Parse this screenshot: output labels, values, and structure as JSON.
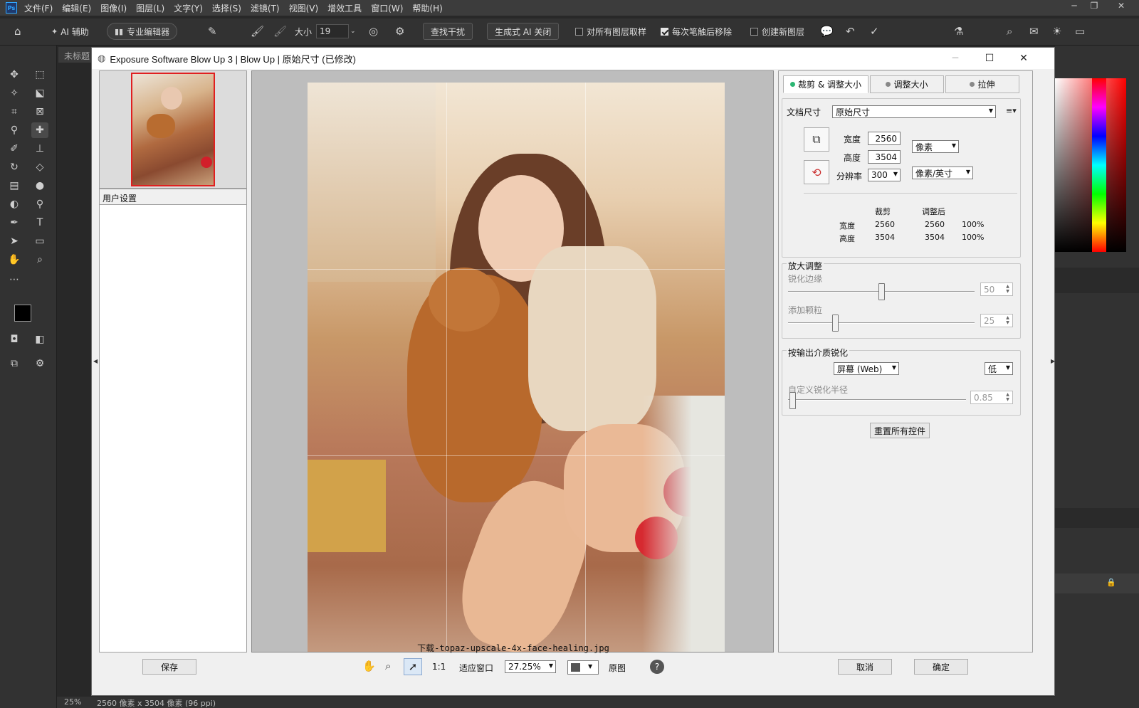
{
  "app": {
    "logo": "Ps",
    "menu": [
      "文件(F)",
      "编辑(E)",
      "图像(I)",
      "图层(L)",
      "文字(Y)",
      "选择(S)",
      "滤镜(T)",
      "视图(V)",
      "增效工具",
      "窗口(W)",
      "帮助(H)"
    ]
  },
  "options": {
    "ai_assist": "AI 辅助",
    "pro_editor": "专业编辑器",
    "size_label": "大小",
    "size_value": "19",
    "find_distractions": "查找干扰",
    "gen_ai_off": "生成式 AI 关闭",
    "sample_all_layers": "对所有图层取样",
    "sample_all_checked": false,
    "remove_after_stroke": "每次笔触后移除",
    "remove_after_checked": true,
    "create_new_layer": "创建新图层",
    "create_new_checked": false
  },
  "doc_tab": "未标题",
  "status": {
    "zoom": "25%",
    "info": "2560 像素 x 3504 像素 (96 ppi)"
  },
  "dialog": {
    "title": "Exposure Software Blow Up 3 | Blow Up | 原始尺寸 (已修改)",
    "user_settings": "用户设置",
    "save": "保存",
    "filename": "下载-topaz-upscale-4x-face-healing.jpg",
    "tabs": [
      "裁剪 & 调整大小",
      "调整大小",
      "拉伸"
    ],
    "doc_size_label": "文档尺寸",
    "doc_size_value": "原始尺寸",
    "width_label": "宽度",
    "width_value": "2560",
    "height_label": "高度",
    "height_value": "3504",
    "unit": "像素",
    "resolution_label": "分辨率",
    "resolution_value": "300",
    "res_unit": "像素/英寸",
    "table": {
      "col_crop": "裁剪",
      "col_after": "调整后",
      "rows": [
        {
          "label": "宽度",
          "crop": "2560",
          "after": "2560",
          "pct": "100%"
        },
        {
          "label": "高度",
          "crop": "3504",
          "after": "3504",
          "pct": "100%"
        }
      ]
    },
    "enlarge_group": "放大调整",
    "sharpen_edges": "锐化边缘",
    "sharpen_value": "50",
    "sharpen_level": 0.5,
    "add_grain": "添加颗粒",
    "grain_value": "25",
    "grain_level": 0.25,
    "output_group": "按输出介质锐化",
    "medium": "屏幕 (Web)",
    "medium_level": "低",
    "custom_radius": "自定义锐化半径",
    "radius_value": "0.85",
    "reset": "重置所有控件",
    "cancel": "取消",
    "ok": "确定",
    "zoom_1to1": "1:1",
    "fit_window": "适应窗口",
    "zoom_value": "27.25%",
    "original": "原图"
  },
  "colors": {
    "dialog_bg": "#f0f0f0",
    "ps_dark": "#323232",
    "active_tab_dot": "#2bb673"
  }
}
